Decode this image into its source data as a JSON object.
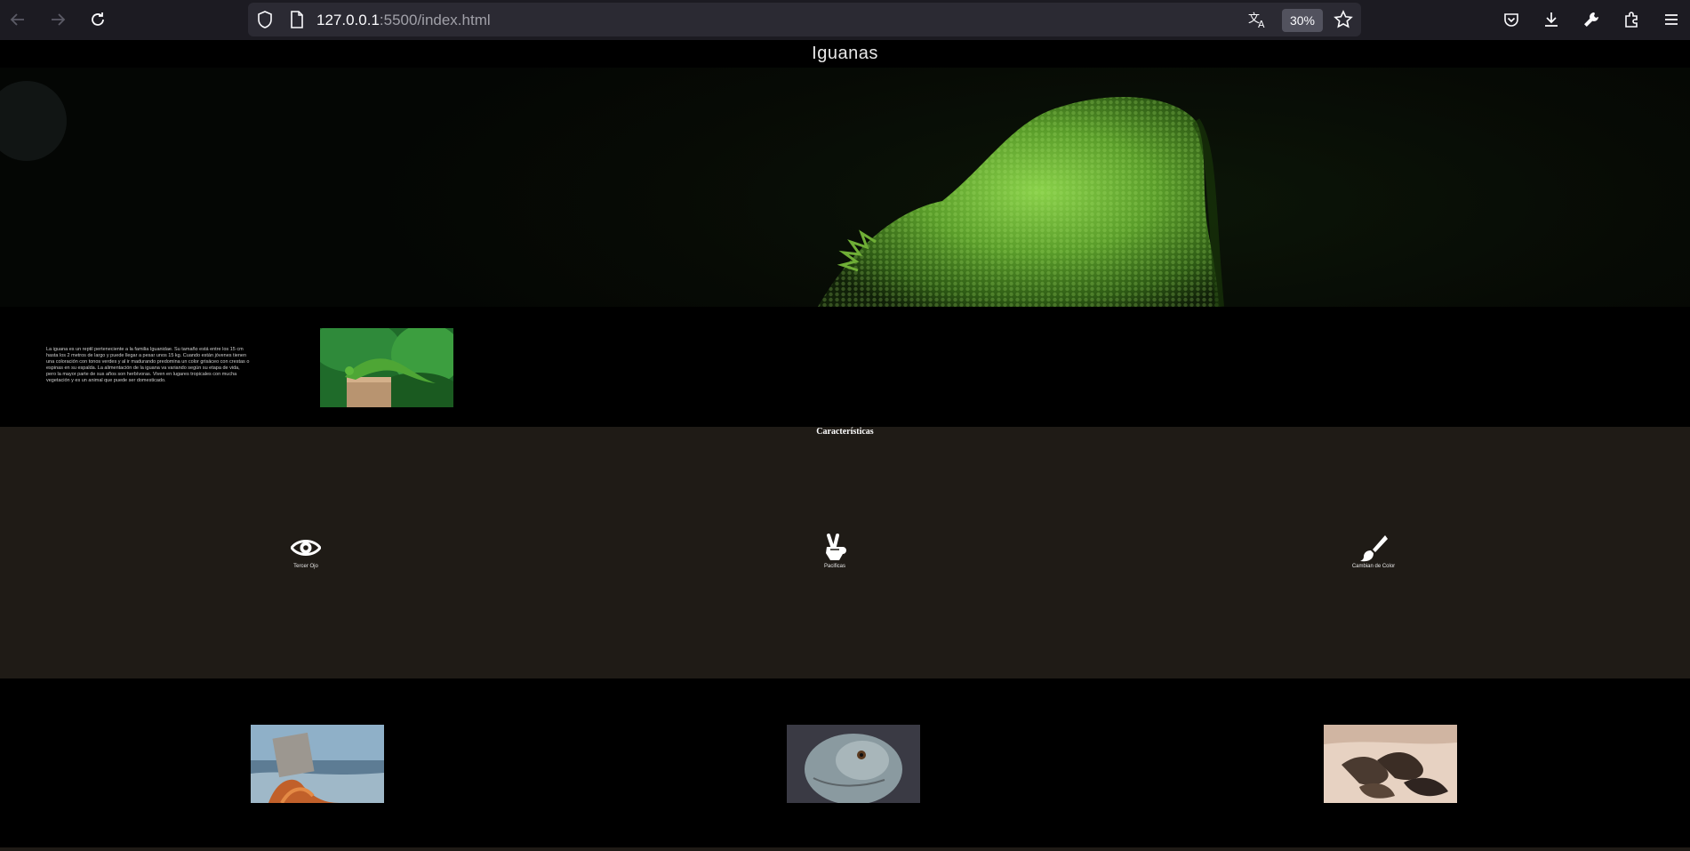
{
  "browser": {
    "url_host": "127.0.0.1",
    "url_path": ":5500/index.html",
    "zoom": "30%",
    "icons": [
      "back-arrow-icon",
      "forward-arrow-icon",
      "reload-icon",
      "shield-icon",
      "page-icon",
      "translate-icon",
      "bookmark-star-icon",
      "pocket-icon",
      "download-icon",
      "wrench-icon",
      "extensions-icon",
      "menu-icon"
    ]
  },
  "page": {
    "title": "Iguanas",
    "intro_text": "La iguana es un reptil perteneciente a la familia Iguanidae. Su tamaño está entre los 15 cm hasta los 2 metros de largo y puede llegar a pesar unos 15 kg. Cuando están jóvenes tienen una coloración con tonos verdes y al ir madurando predomina un color grisáceo con crestas o espinas en su espalda. La alimentación de la iguana va variando según su etapa de vida, pero la mayor parte de sus años son herbívoras. Viven en lugares tropicales con mucha vegetación y es un animal que puede ser domesticado.",
    "features_title": "Características",
    "features": [
      {
        "label": "Tercer Ojo",
        "icon": "eye-icon"
      },
      {
        "label": "Pacificas",
        "icon": "peace-hand-icon"
      },
      {
        "label": "Cambian de Color",
        "icon": "paintbrush-icon"
      }
    ]
  },
  "colors": {
    "chrome_bg": "#1c1b22",
    "urlbar_bg": "#2b2a33",
    "features_bg": "#1f1b16",
    "page_bg": "#000000"
  }
}
